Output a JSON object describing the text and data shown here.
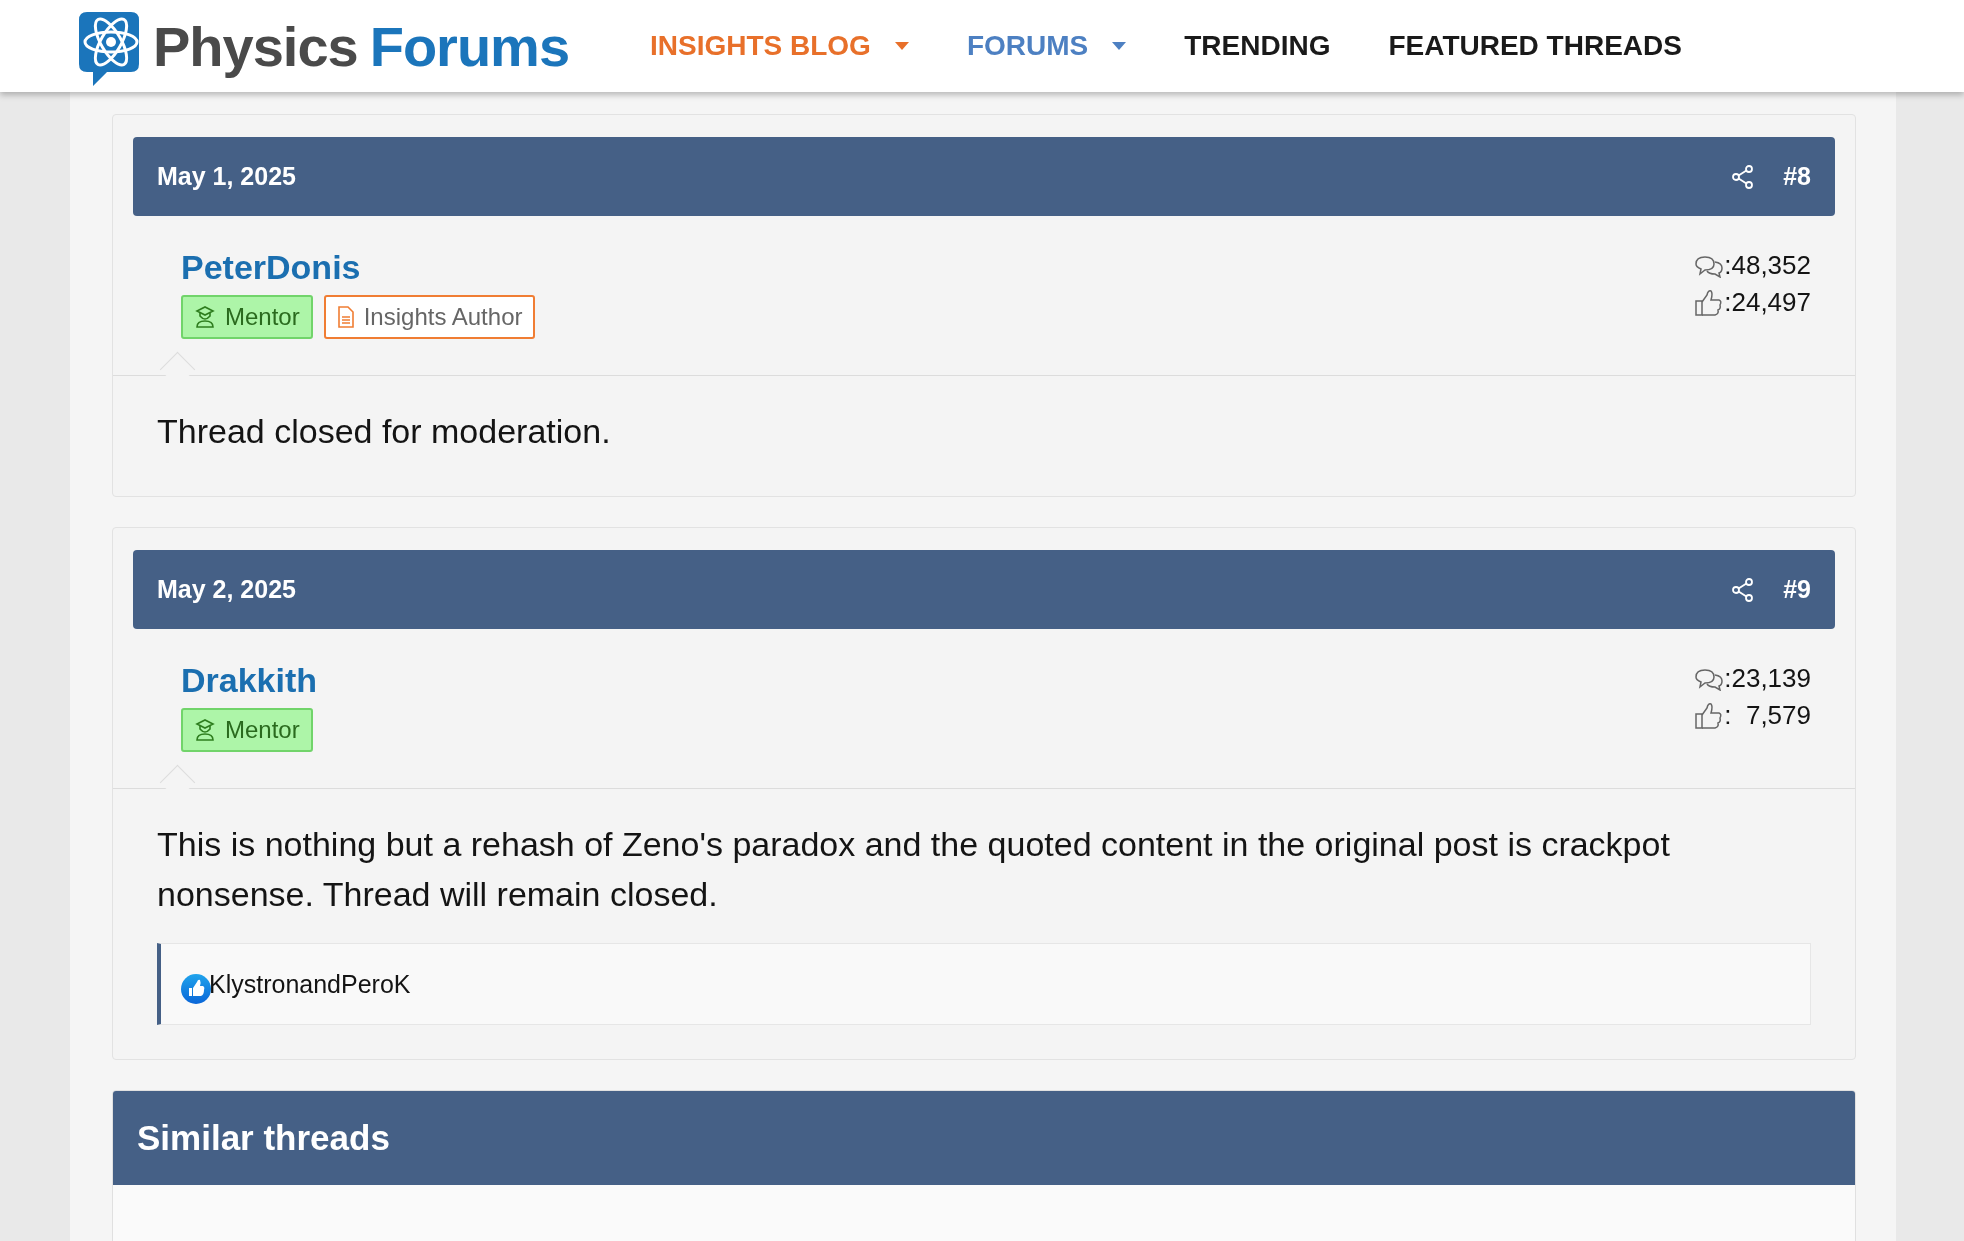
{
  "header": {
    "logo": {
      "word_1": "Physics",
      "word_2": "Forums"
    },
    "nav": [
      {
        "label": "INSIGHTS BLOG",
        "color": "#e8702a",
        "dropdown": true
      },
      {
        "label": "FORUMS",
        "color": "#4d80c2",
        "dropdown": true
      },
      {
        "label": "TRENDING",
        "color": "#1a1a1a",
        "dropdown": false
      },
      {
        "label": "FEATURED THREADS",
        "color": "#1a1a1a",
        "dropdown": false
      }
    ]
  },
  "posts": [
    {
      "date": "May 1, 2025",
      "number": "#8",
      "user": "PeterDonis",
      "badges": [
        {
          "kind": "mentor",
          "label": "Mentor"
        },
        {
          "kind": "author",
          "label": "Insights Author"
        }
      ],
      "messages": ":48,352",
      "likes": ":24,497",
      "body": "Thread closed for moderation."
    },
    {
      "date": "May 2, 2025",
      "number": "#9",
      "user": "Drakkith",
      "badges": [
        {
          "kind": "mentor",
          "label": "Mentor"
        }
      ],
      "messages": ":23,139",
      "likes": ":  7,579",
      "body": "This is nothing but a rehash of Zeno's paradox and the quoted content in the original post is crackpot nonsense. Thread will remain closed.",
      "reactions": "KlystronandPeroK"
    }
  ],
  "similar": {
    "title": "Similar threads"
  }
}
